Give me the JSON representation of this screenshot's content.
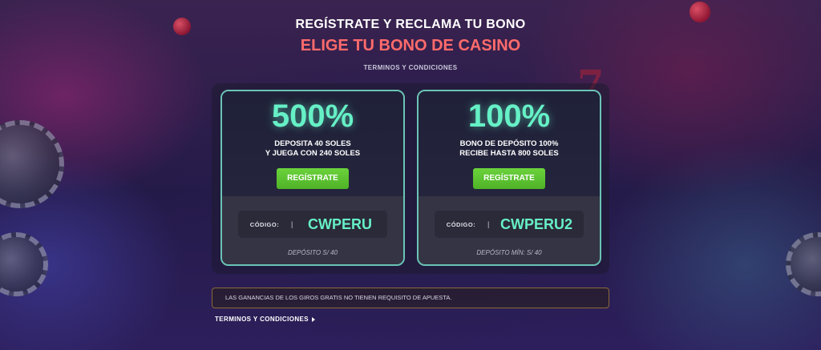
{
  "header": {
    "line1": "REGÍSTRATE Y RECLAMA TU BONO",
    "line2": "ELIGE TU BONO DE CASINO",
    "terms": "TERMINOS Y CONDICIONES"
  },
  "offers": [
    {
      "percent": "500%",
      "desc_line1": "DEPOSITA 40 SOLES",
      "desc_line2": "Y JUEGA CON 240 SOLES",
      "button_label": "REGÍSTRATE",
      "code_label": "CÓDIGO:",
      "code_separator": "|",
      "code_value": "CWPERU",
      "deposit": "DEPÓSITO S/ 40"
    },
    {
      "percent": "100%",
      "desc_line1": "BONO DE DEPÓSITO 100%",
      "desc_line2": "RECIBE HASTA 800 SOLES",
      "button_label": "REGÍSTRATE",
      "code_label": "CÓDIGO:",
      "code_separator": "|",
      "code_value": "CWPERU2",
      "deposit": "DEPÓSITO MÍN: S/ 40"
    }
  ],
  "notice": "LAS GANANCIAS DE LOS GIROS GRATIS NO TIENEN REQUISITO DE APUESTA.",
  "footer": {
    "terms_link": "TERMINOS Y CONDICIONES",
    "terms_icon": "caret-right-icon"
  },
  "colors": {
    "accent_teal": "#66f0c6",
    "title_red": "#ff6b6b",
    "button_green": "#5cc131",
    "card_border": "#6ac4b6",
    "notice_border": "#8a6a38"
  }
}
